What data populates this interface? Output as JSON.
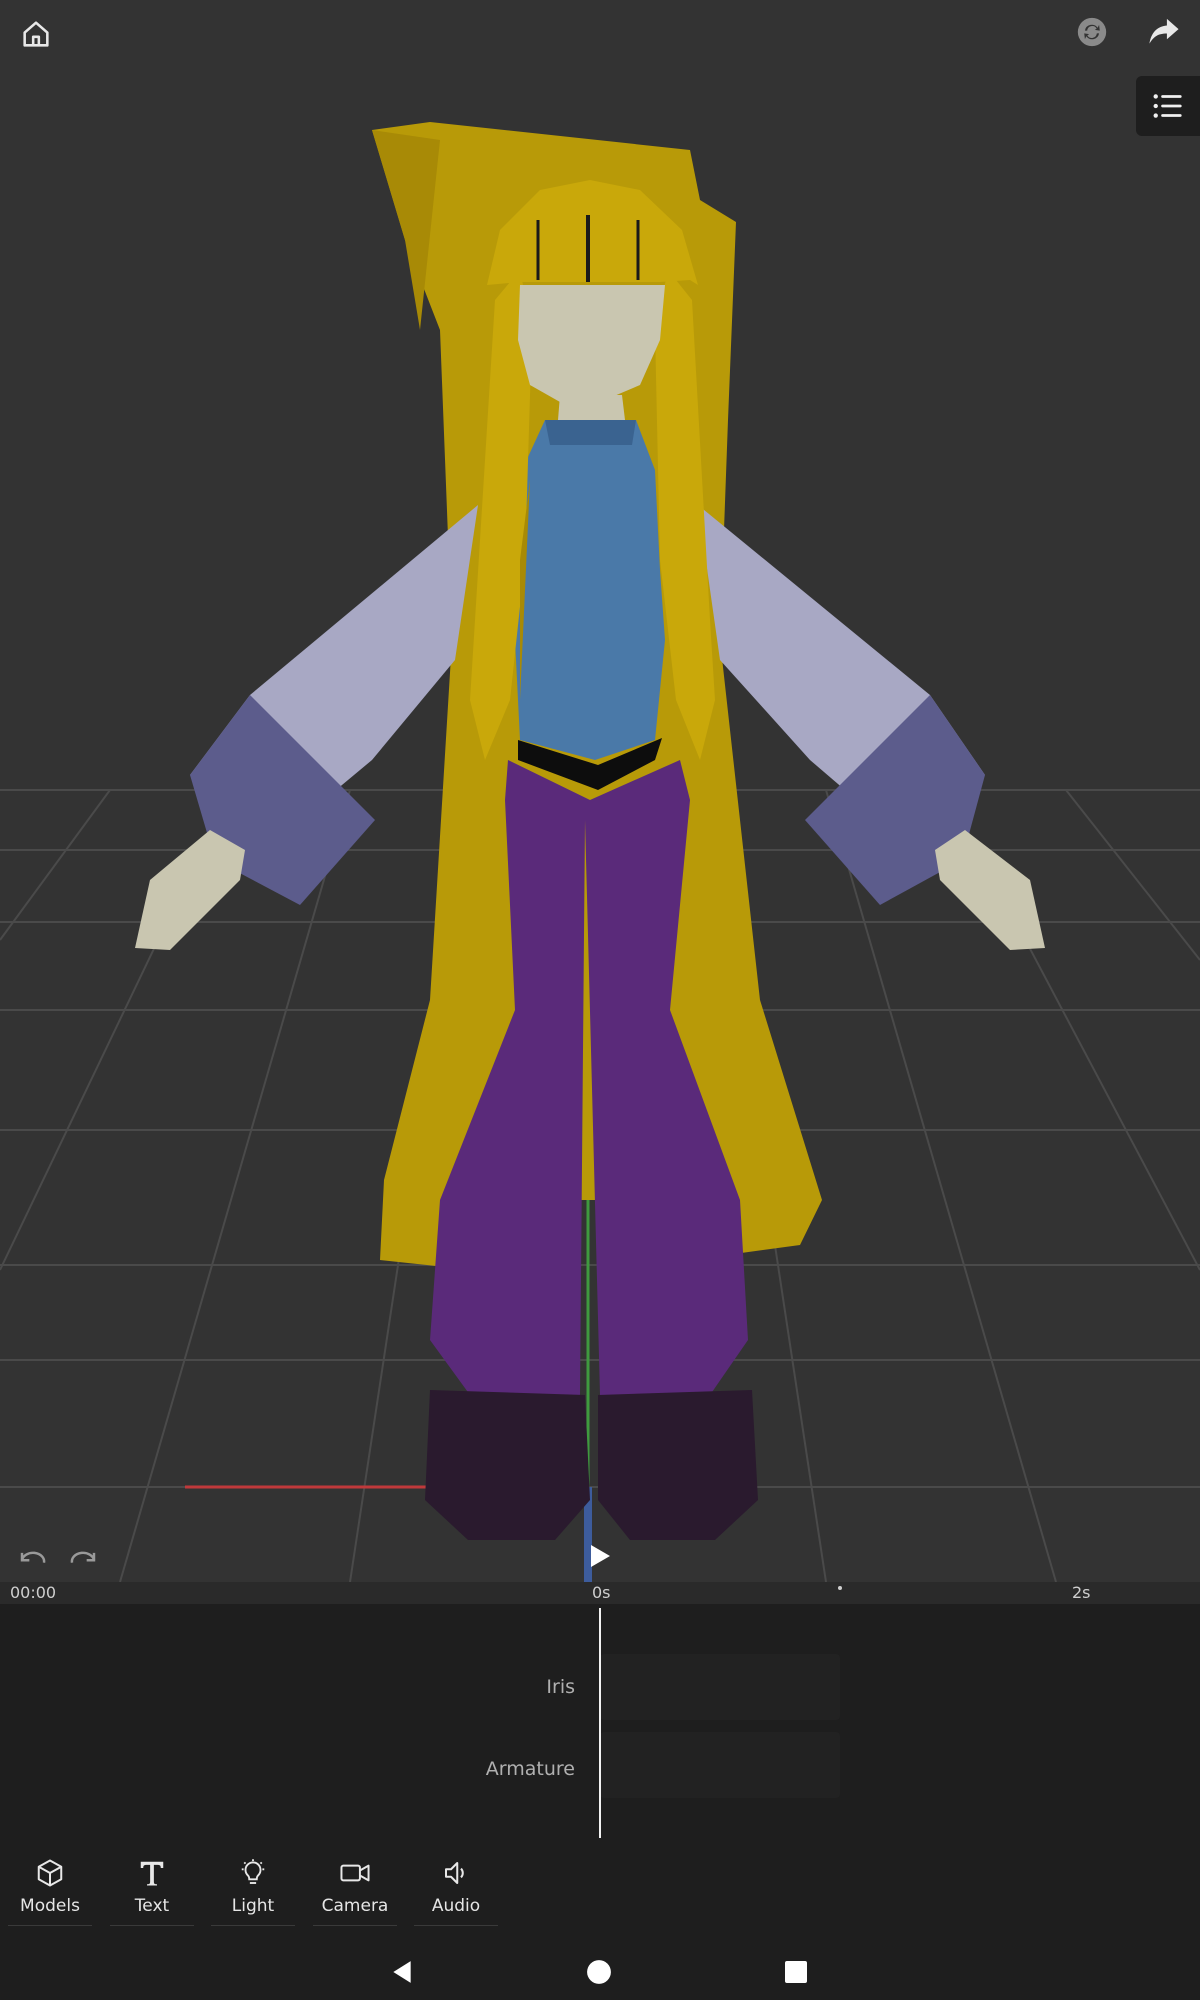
{
  "header": {
    "icons": [
      "home-icon",
      "sync-icon",
      "share-icon",
      "list-menu-icon"
    ]
  },
  "playback": {
    "current_time": "00:00",
    "ruler_start": "0s",
    "ruler_end": "2s"
  },
  "tracks": [
    {
      "label": "Iris"
    },
    {
      "label": "Armature"
    }
  ],
  "toolbar": {
    "items": [
      {
        "label": "Models",
        "icon": "cube-icon"
      },
      {
        "label": "Text",
        "icon": "text-icon"
      },
      {
        "label": "Light",
        "icon": "bulb-icon"
      },
      {
        "label": "Camera",
        "icon": "camera-icon"
      },
      {
        "label": "Audio",
        "icon": "speaker-icon"
      }
    ]
  },
  "colors": {
    "hair": "#b89a08",
    "shirt": "#4a79a8",
    "pants": "#5a2a7a",
    "boots": "#2a1a2e",
    "sleeve": "#a8a8c4",
    "cuff": "#5c5c8c",
    "skin": "#c9c6b0"
  }
}
